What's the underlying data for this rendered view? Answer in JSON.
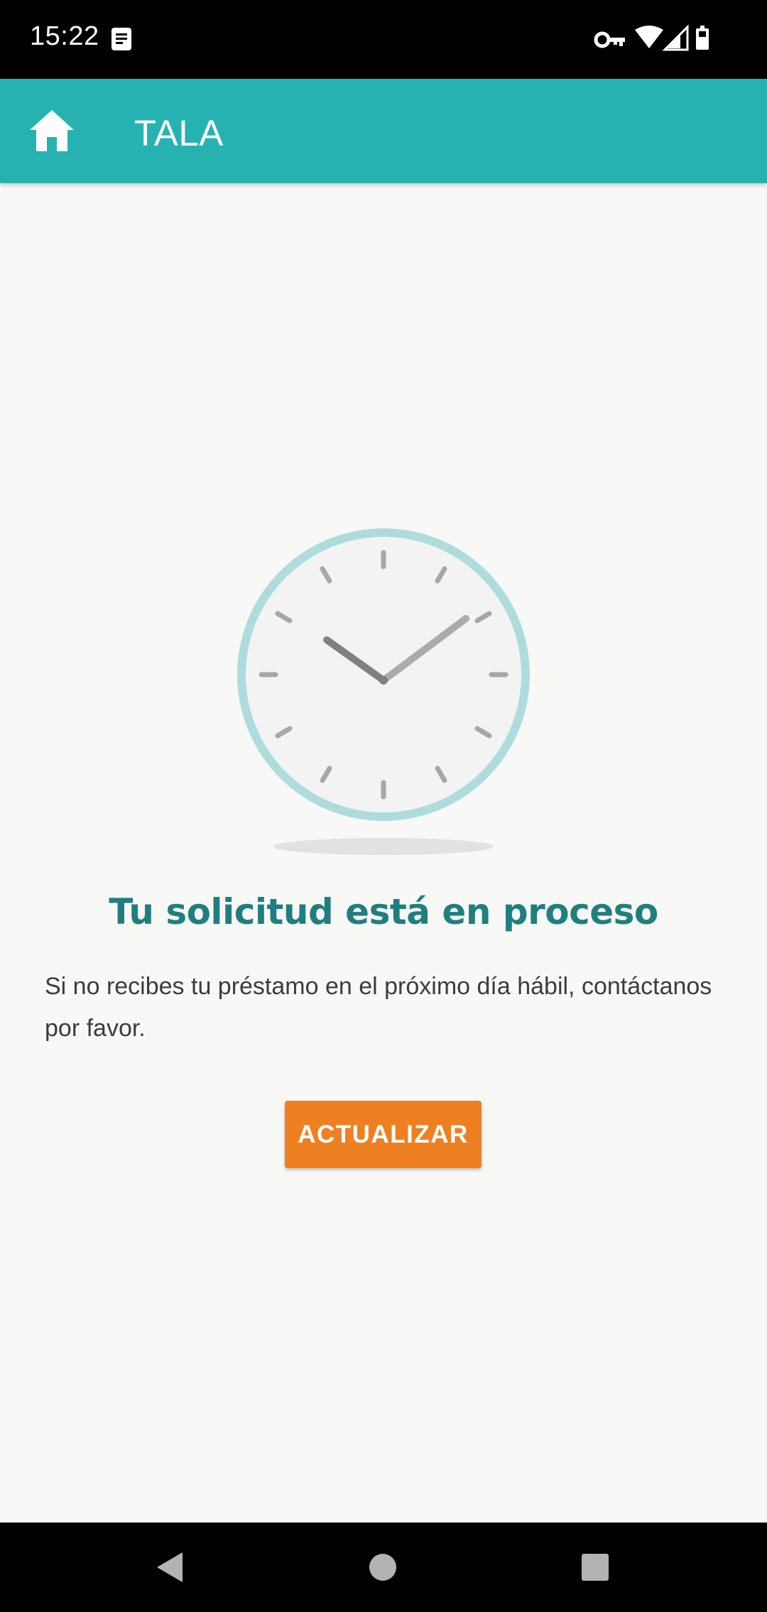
{
  "status_bar": {
    "time": "15:22",
    "icons": [
      "notification-doc-icon",
      "vpn-key-icon",
      "wifi-icon",
      "signal-icon",
      "battery-icon"
    ]
  },
  "app_bar": {
    "title": "TALA",
    "home_icon": "home-icon",
    "background": "#27b2b2"
  },
  "main": {
    "illustration": "clock-icon",
    "headline": "Tu solicitud está en proceso",
    "message": "Si no recibes tu préstamo en el próximo día hábil, contáctanos por favor.",
    "refresh_button": "ACTUALIZAR"
  },
  "colors": {
    "accent": "#ef8021",
    "headline": "#1f7f7e",
    "clock_ring": "#aedcdc"
  },
  "nav_bar": {
    "buttons": [
      "back-icon",
      "home-circle-icon",
      "recents-icon"
    ]
  }
}
